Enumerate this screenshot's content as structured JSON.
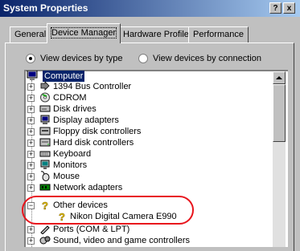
{
  "window": {
    "title": "System Properties",
    "help_label": "?",
    "close_label": "x"
  },
  "tabs": [
    {
      "label": "General",
      "active": false
    },
    {
      "label": "Device Manager",
      "active": true
    },
    {
      "label": "Hardware Profiles",
      "active": false
    },
    {
      "label": "Performance",
      "active": false
    }
  ],
  "view_options": [
    {
      "label": "View devices by type",
      "selected": true
    },
    {
      "label": "View devices by connection",
      "selected": false
    }
  ],
  "tree": {
    "root": {
      "label": "Computer",
      "icon": "computer-icon",
      "selected": true
    },
    "items": [
      {
        "label": "1394 Bus Controller",
        "icon": "bus-controller-icon",
        "expander": "+"
      },
      {
        "label": "CDROM",
        "icon": "cdrom-icon",
        "expander": "+"
      },
      {
        "label": "Disk drives",
        "icon": "disk-drive-icon",
        "expander": "+"
      },
      {
        "label": "Display adapters",
        "icon": "display-adapter-icon",
        "expander": "+"
      },
      {
        "label": "Floppy disk controllers",
        "icon": "floppy-controller-icon",
        "expander": "+"
      },
      {
        "label": "Hard disk controllers",
        "icon": "hard-disk-controller-icon",
        "expander": "+"
      },
      {
        "label": "Keyboard",
        "icon": "keyboard-icon",
        "expander": "+"
      },
      {
        "label": "Monitors",
        "icon": "monitor-icon",
        "expander": "+"
      },
      {
        "label": "Mouse",
        "icon": "mouse-icon",
        "expander": "+"
      },
      {
        "label": "Network adapters",
        "icon": "network-adapter-icon",
        "expander": "+"
      },
      {
        "label": "Other devices",
        "icon": "unknown-device-icon",
        "expander": "−"
      },
      {
        "label": "Nikon Digital Camera E990",
        "icon": "unknown-device-icon",
        "child": true
      },
      {
        "label": "Ports (COM & LPT)",
        "icon": "port-icon",
        "expander": "+"
      },
      {
        "label": "Sound, video and game controllers",
        "icon": "sound-controller-icon",
        "expander": "+"
      }
    ]
  },
  "colors": {
    "title_bar_start": "#0a246a",
    "title_bar_end": "#a6caf0",
    "window_face": "#c0c0c0",
    "selection": "#0a246a",
    "highlight_oval": "#e8141c"
  }
}
